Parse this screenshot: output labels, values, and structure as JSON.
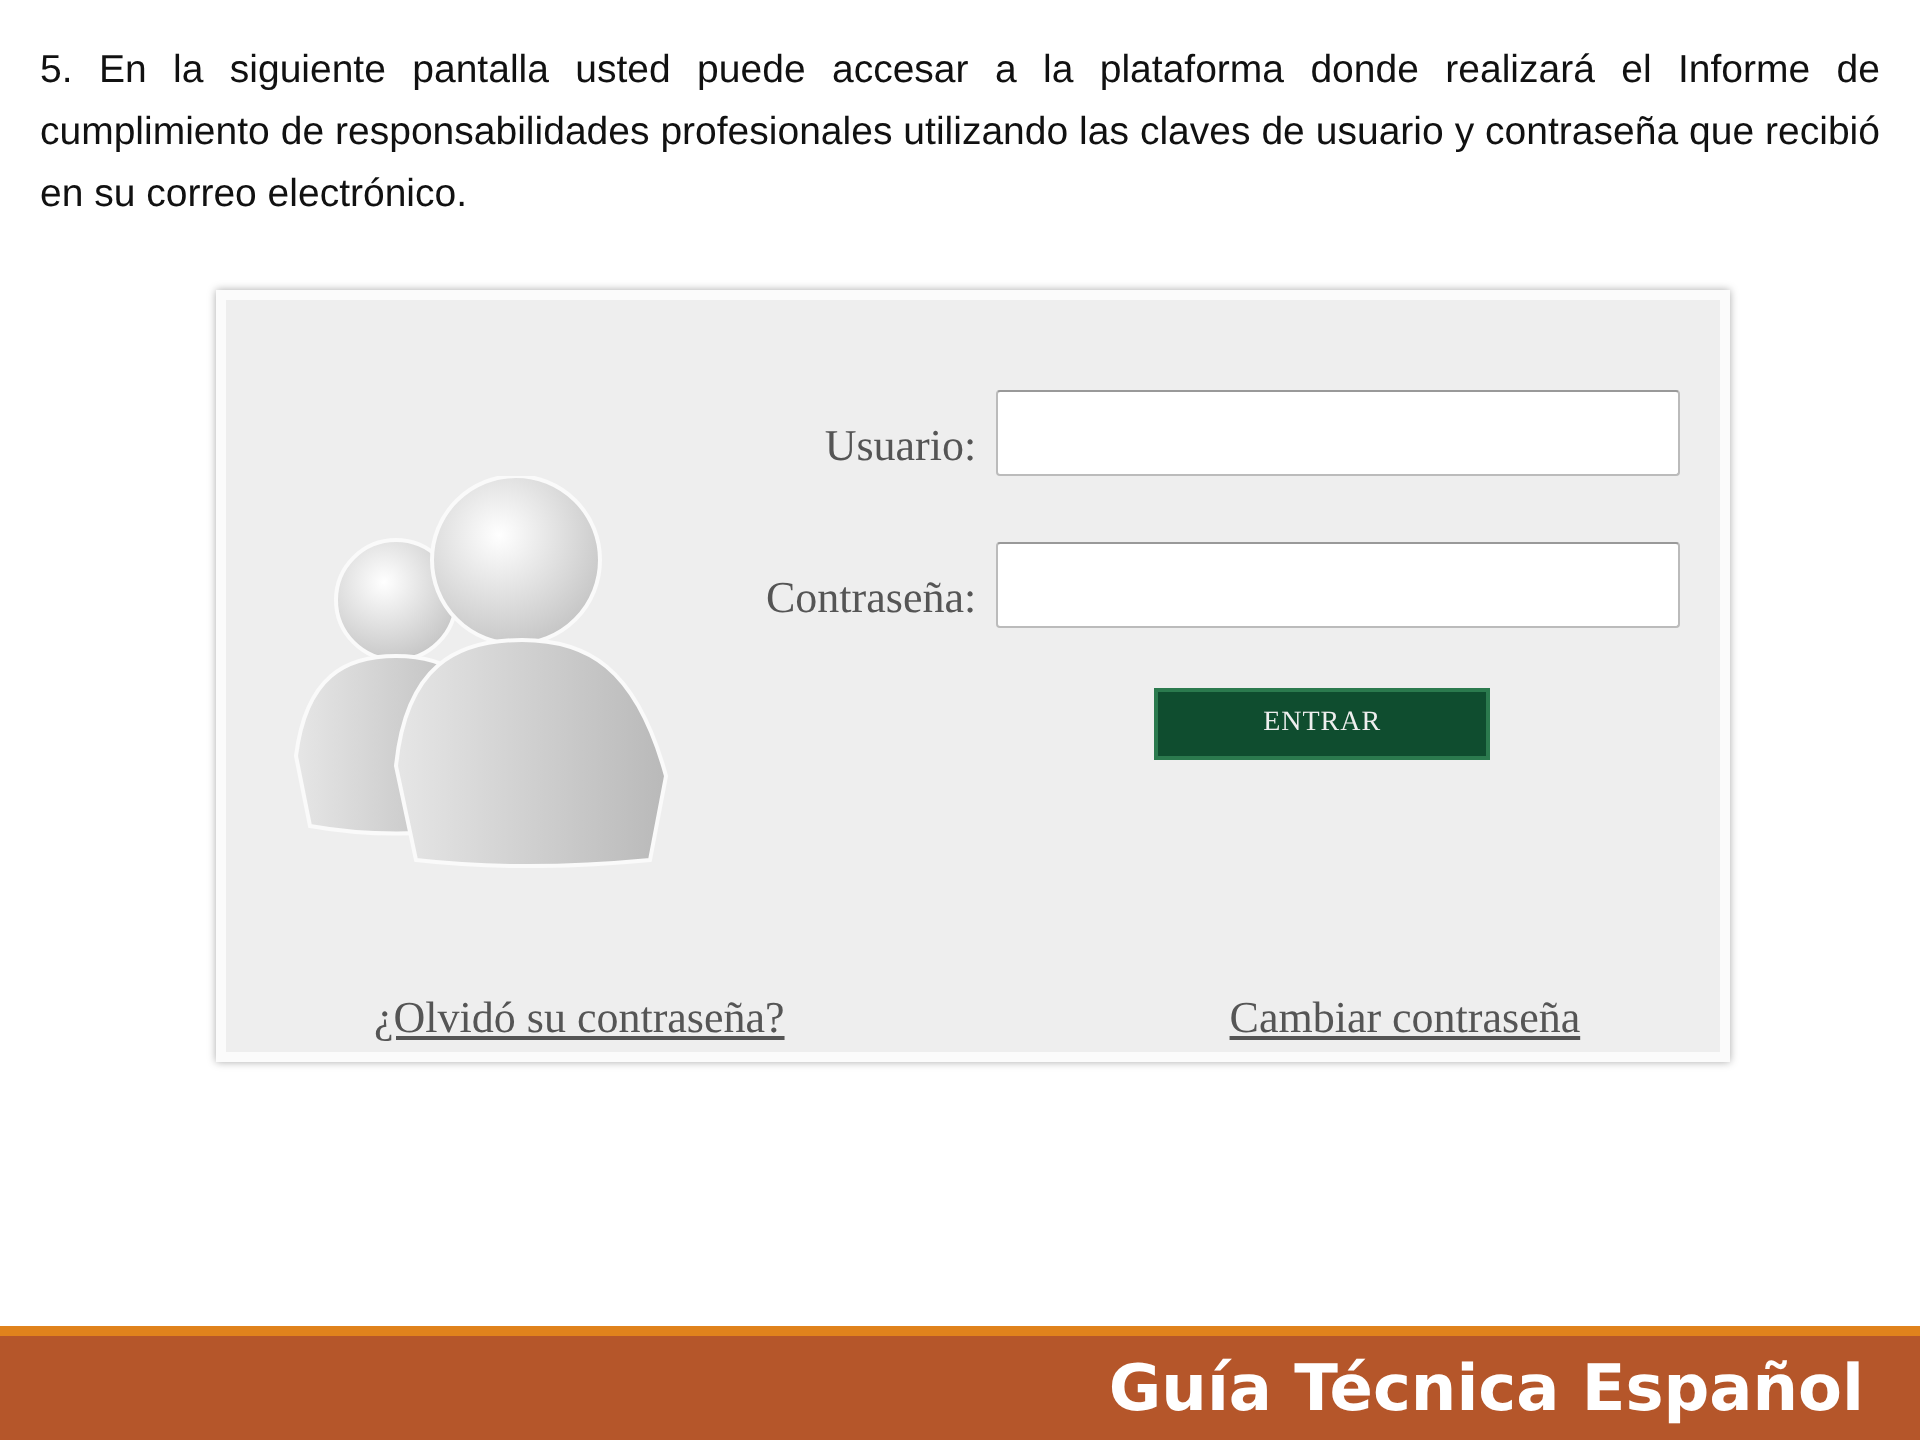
{
  "instruction": "5. En la siguiente pantalla usted puede accesar a la plataforma donde realizará el Informe de cumplimiento de responsabilidades profesionales utilizando las claves de usuario y contraseña que recibió en su correo electrónico.",
  "login": {
    "fields": [
      {
        "label": "Usuario:"
      },
      {
        "label": "Contraseña:"
      }
    ],
    "submit": "ENTRAR",
    "links": [
      "¿Olvidó su contraseña?",
      "Cambiar contraseña"
    ]
  },
  "footer": {
    "title": "Guía Técnica Español"
  }
}
